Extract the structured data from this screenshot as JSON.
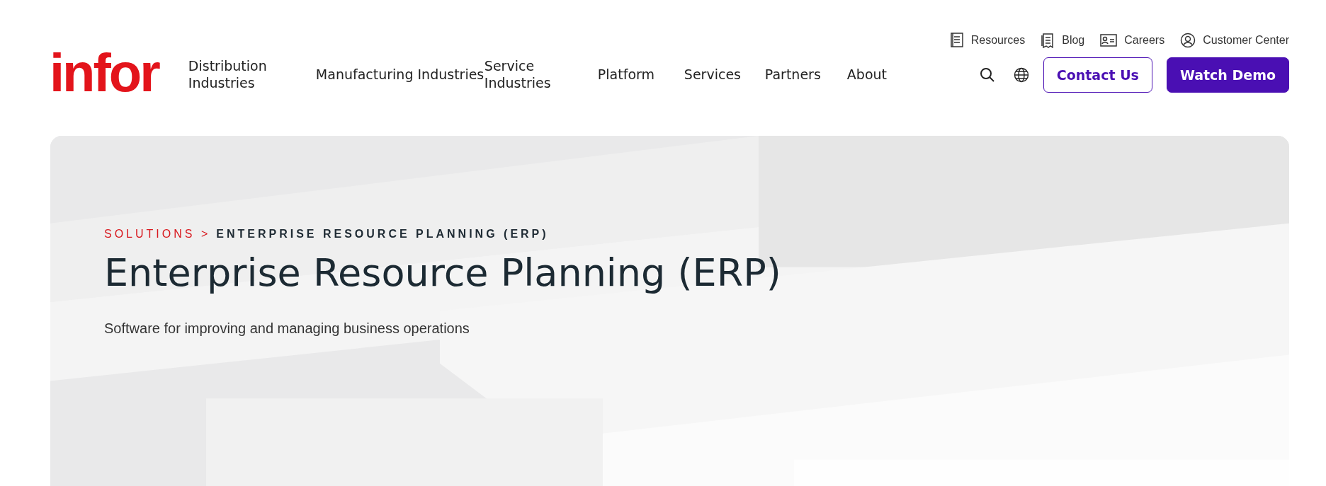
{
  "utility_links": [
    {
      "kind": "book",
      "label": "Resources"
    },
    {
      "kind": "blog",
      "label": "Blog"
    },
    {
      "kind": "card",
      "label": "Careers"
    },
    {
      "kind": "user",
      "label": "Customer Center"
    }
  ],
  "logo": {
    "text": "infor"
  },
  "nav": {
    "items": [
      {
        "label": "Distribution Industries"
      },
      {
        "label": "Manufacturing Industries"
      },
      {
        "label": "Service Industries"
      },
      {
        "label": "Platform"
      },
      {
        "label": "Services"
      },
      {
        "label": "Partners"
      },
      {
        "label": "About"
      }
    ],
    "buttons": [
      {
        "kind": "outline",
        "label": "Contact Us"
      },
      {
        "kind": "solid",
        "label": "Watch Demo"
      }
    ]
  },
  "hero": {
    "breadcrumb": [
      {
        "label": "SOLUTIONS >",
        "kind": "link"
      },
      {
        "label": "ENTERPRISE RESOURCE PLANNING (ERP)",
        "kind": "current"
      }
    ],
    "title": "Enterprise Resource Planning (ERP)",
    "subtitle": "Software for improving and managing business operations"
  }
}
